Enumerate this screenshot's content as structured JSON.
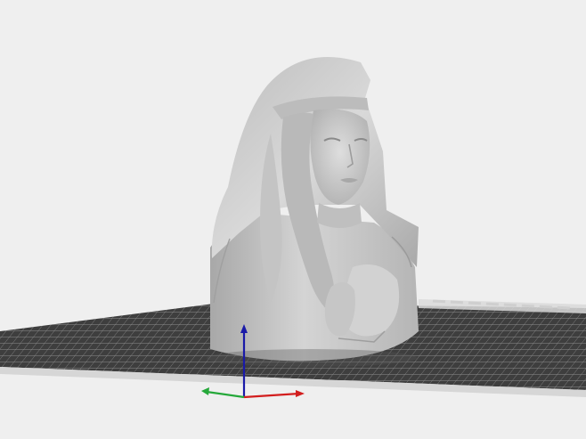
{
  "viewport": {
    "background_color": "#efefef",
    "bed_color": "#3f3f3f",
    "bed_edge_color": "#cfcfcf",
    "model_color": "#c9c9c9",
    "model_shadow_color": "#9a9a9a",
    "model_highlight_color": "#e2e2e2",
    "grid_line_color": "#8a8a8a"
  },
  "axes": {
    "x_color": "#d21e1e",
    "y_color": "#25a83a",
    "z_color": "#1a1aa8"
  },
  "model": {
    "icon": "bust-model-icon"
  }
}
